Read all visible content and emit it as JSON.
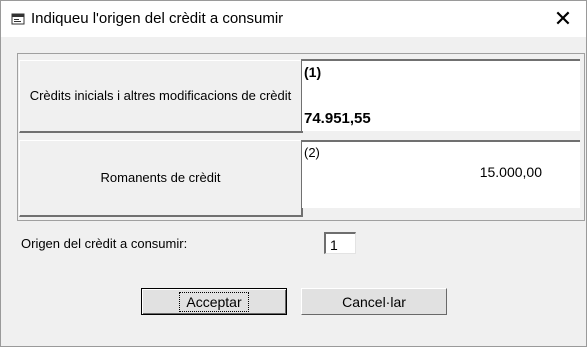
{
  "dialog": {
    "title": "Indiqueu l'origen del crèdit a consumir",
    "close_glyph": "✕"
  },
  "rows": [
    {
      "label": "Crèdits inicials i altres modificacions de crèdit",
      "index": "(1)",
      "value": "74.951,55"
    },
    {
      "label": "Romanents de crèdit",
      "index": "(2)",
      "value": "15.000,00"
    }
  ],
  "origen": {
    "label": "Origen del crèdit a consumir:",
    "value": "1"
  },
  "buttons": {
    "accept": "Acceptar",
    "cancel": "Cancel·lar"
  }
}
